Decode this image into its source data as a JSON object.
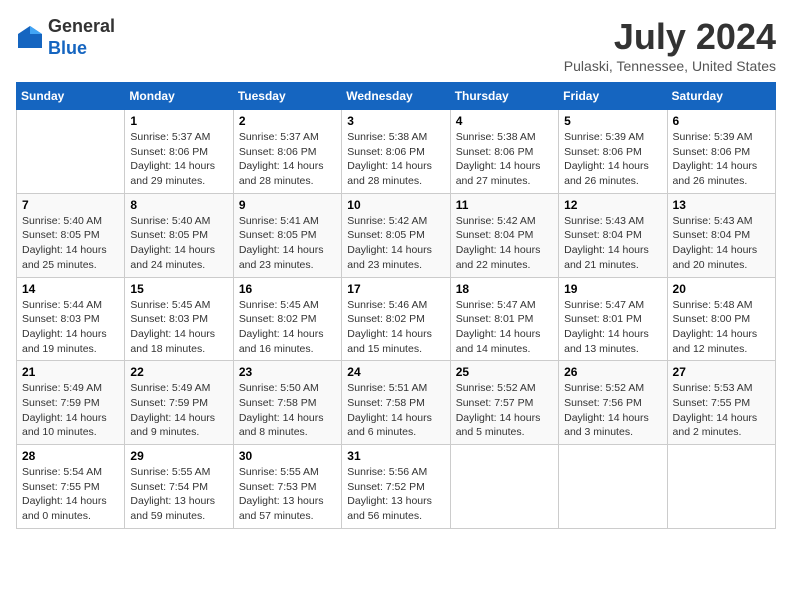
{
  "header": {
    "logo_general": "General",
    "logo_blue": "Blue",
    "month_title": "July 2024",
    "location": "Pulaski, Tennessee, United States"
  },
  "days_of_week": [
    "Sunday",
    "Monday",
    "Tuesday",
    "Wednesday",
    "Thursday",
    "Friday",
    "Saturday"
  ],
  "weeks": [
    [
      {
        "day": "",
        "info": ""
      },
      {
        "day": "1",
        "info": "Sunrise: 5:37 AM\nSunset: 8:06 PM\nDaylight: 14 hours\nand 29 minutes."
      },
      {
        "day": "2",
        "info": "Sunrise: 5:37 AM\nSunset: 8:06 PM\nDaylight: 14 hours\nand 28 minutes."
      },
      {
        "day": "3",
        "info": "Sunrise: 5:38 AM\nSunset: 8:06 PM\nDaylight: 14 hours\nand 28 minutes."
      },
      {
        "day": "4",
        "info": "Sunrise: 5:38 AM\nSunset: 8:06 PM\nDaylight: 14 hours\nand 27 minutes."
      },
      {
        "day": "5",
        "info": "Sunrise: 5:39 AM\nSunset: 8:06 PM\nDaylight: 14 hours\nand 26 minutes."
      },
      {
        "day": "6",
        "info": "Sunrise: 5:39 AM\nSunset: 8:06 PM\nDaylight: 14 hours\nand 26 minutes."
      }
    ],
    [
      {
        "day": "7",
        "info": "Sunrise: 5:40 AM\nSunset: 8:05 PM\nDaylight: 14 hours\nand 25 minutes."
      },
      {
        "day": "8",
        "info": "Sunrise: 5:40 AM\nSunset: 8:05 PM\nDaylight: 14 hours\nand 24 minutes."
      },
      {
        "day": "9",
        "info": "Sunrise: 5:41 AM\nSunset: 8:05 PM\nDaylight: 14 hours\nand 23 minutes."
      },
      {
        "day": "10",
        "info": "Sunrise: 5:42 AM\nSunset: 8:05 PM\nDaylight: 14 hours\nand 23 minutes."
      },
      {
        "day": "11",
        "info": "Sunrise: 5:42 AM\nSunset: 8:04 PM\nDaylight: 14 hours\nand 22 minutes."
      },
      {
        "day": "12",
        "info": "Sunrise: 5:43 AM\nSunset: 8:04 PM\nDaylight: 14 hours\nand 21 minutes."
      },
      {
        "day": "13",
        "info": "Sunrise: 5:43 AM\nSunset: 8:04 PM\nDaylight: 14 hours\nand 20 minutes."
      }
    ],
    [
      {
        "day": "14",
        "info": "Sunrise: 5:44 AM\nSunset: 8:03 PM\nDaylight: 14 hours\nand 19 minutes."
      },
      {
        "day": "15",
        "info": "Sunrise: 5:45 AM\nSunset: 8:03 PM\nDaylight: 14 hours\nand 18 minutes."
      },
      {
        "day": "16",
        "info": "Sunrise: 5:45 AM\nSunset: 8:02 PM\nDaylight: 14 hours\nand 16 minutes."
      },
      {
        "day": "17",
        "info": "Sunrise: 5:46 AM\nSunset: 8:02 PM\nDaylight: 14 hours\nand 15 minutes."
      },
      {
        "day": "18",
        "info": "Sunrise: 5:47 AM\nSunset: 8:01 PM\nDaylight: 14 hours\nand 14 minutes."
      },
      {
        "day": "19",
        "info": "Sunrise: 5:47 AM\nSunset: 8:01 PM\nDaylight: 14 hours\nand 13 minutes."
      },
      {
        "day": "20",
        "info": "Sunrise: 5:48 AM\nSunset: 8:00 PM\nDaylight: 14 hours\nand 12 minutes."
      }
    ],
    [
      {
        "day": "21",
        "info": "Sunrise: 5:49 AM\nSunset: 7:59 PM\nDaylight: 14 hours\nand 10 minutes."
      },
      {
        "day": "22",
        "info": "Sunrise: 5:49 AM\nSunset: 7:59 PM\nDaylight: 14 hours\nand 9 minutes."
      },
      {
        "day": "23",
        "info": "Sunrise: 5:50 AM\nSunset: 7:58 PM\nDaylight: 14 hours\nand 8 minutes."
      },
      {
        "day": "24",
        "info": "Sunrise: 5:51 AM\nSunset: 7:58 PM\nDaylight: 14 hours\nand 6 minutes."
      },
      {
        "day": "25",
        "info": "Sunrise: 5:52 AM\nSunset: 7:57 PM\nDaylight: 14 hours\nand 5 minutes."
      },
      {
        "day": "26",
        "info": "Sunrise: 5:52 AM\nSunset: 7:56 PM\nDaylight: 14 hours\nand 3 minutes."
      },
      {
        "day": "27",
        "info": "Sunrise: 5:53 AM\nSunset: 7:55 PM\nDaylight: 14 hours\nand 2 minutes."
      }
    ],
    [
      {
        "day": "28",
        "info": "Sunrise: 5:54 AM\nSunset: 7:55 PM\nDaylight: 14 hours\nand 0 minutes."
      },
      {
        "day": "29",
        "info": "Sunrise: 5:55 AM\nSunset: 7:54 PM\nDaylight: 13 hours\nand 59 minutes."
      },
      {
        "day": "30",
        "info": "Sunrise: 5:55 AM\nSunset: 7:53 PM\nDaylight: 13 hours\nand 57 minutes."
      },
      {
        "day": "31",
        "info": "Sunrise: 5:56 AM\nSunset: 7:52 PM\nDaylight: 13 hours\nand 56 minutes."
      },
      {
        "day": "",
        "info": ""
      },
      {
        "day": "",
        "info": ""
      },
      {
        "day": "",
        "info": ""
      }
    ]
  ]
}
